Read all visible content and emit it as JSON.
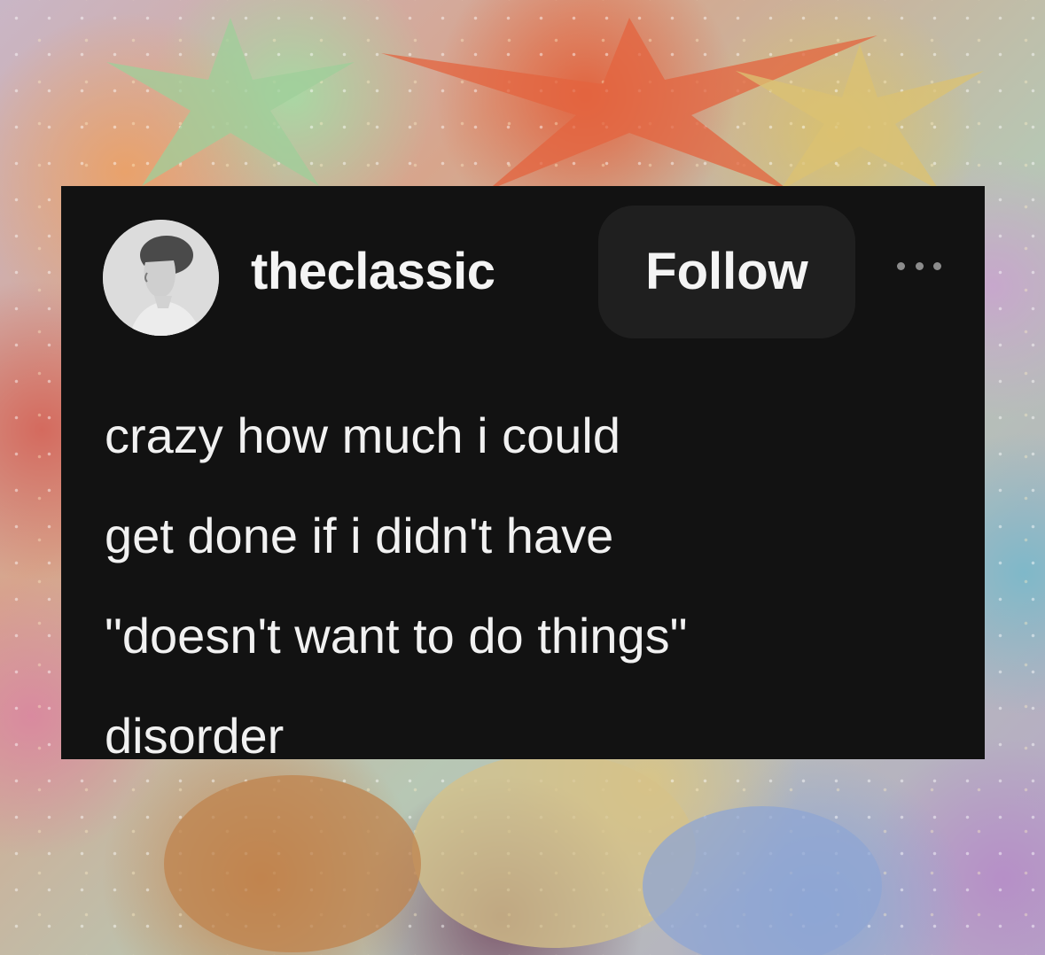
{
  "post": {
    "username": "theclassic",
    "follow_label": "Follow",
    "more_icon": "ellipsis-icon",
    "avatar_icon": "vintage-portrait-avatar",
    "text_lines": [
      "crazy how much i could",
      "get done if i didn't have",
      "\"doesn't want to do things\"",
      "disorder"
    ]
  },
  "colors": {
    "card_background": "#121212",
    "follow_button": "#1f1f1f",
    "text": "#f4f4f4"
  }
}
